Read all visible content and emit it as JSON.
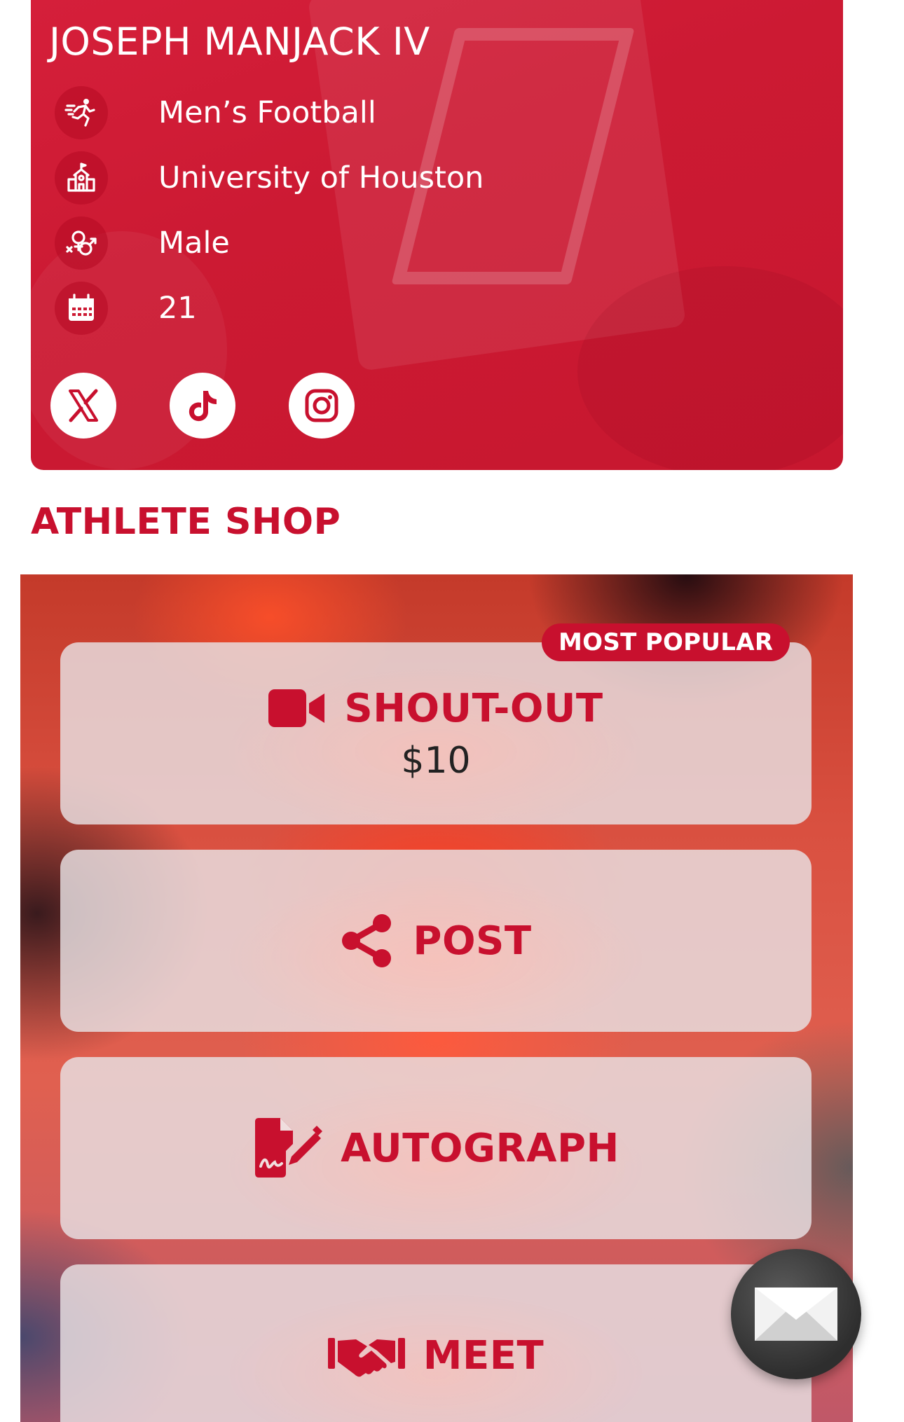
{
  "profile": {
    "name": "JOSEPH MANJACK IV",
    "details": [
      {
        "icon": "running-icon",
        "text": "Men’s Football"
      },
      {
        "icon": "school-icon",
        "text": "University of Houston"
      },
      {
        "icon": "gender-icon",
        "text": "Male"
      },
      {
        "icon": "calendar-icon",
        "text": "21"
      }
    ],
    "socials": [
      "x-twitter-icon",
      "tiktok-icon",
      "instagram-icon"
    ]
  },
  "shop": {
    "title": "ATHLETE SHOP",
    "badge": "MOST POPULAR",
    "items": [
      {
        "icon": "video-camera-icon",
        "label": "SHOUT-OUT",
        "price": "$10"
      },
      {
        "icon": "share-icon",
        "label": "POST"
      },
      {
        "icon": "signature-icon",
        "label": "AUTOGRAPH"
      },
      {
        "icon": "handshake-icon",
        "label": "MEET"
      }
    ]
  },
  "chat_button": {
    "icon": "envelope-icon"
  },
  "colors": {
    "brand_red": "#c8102e",
    "card_red": "#d51f3a",
    "white": "#ffffff",
    "fab_dark": "#333333"
  }
}
